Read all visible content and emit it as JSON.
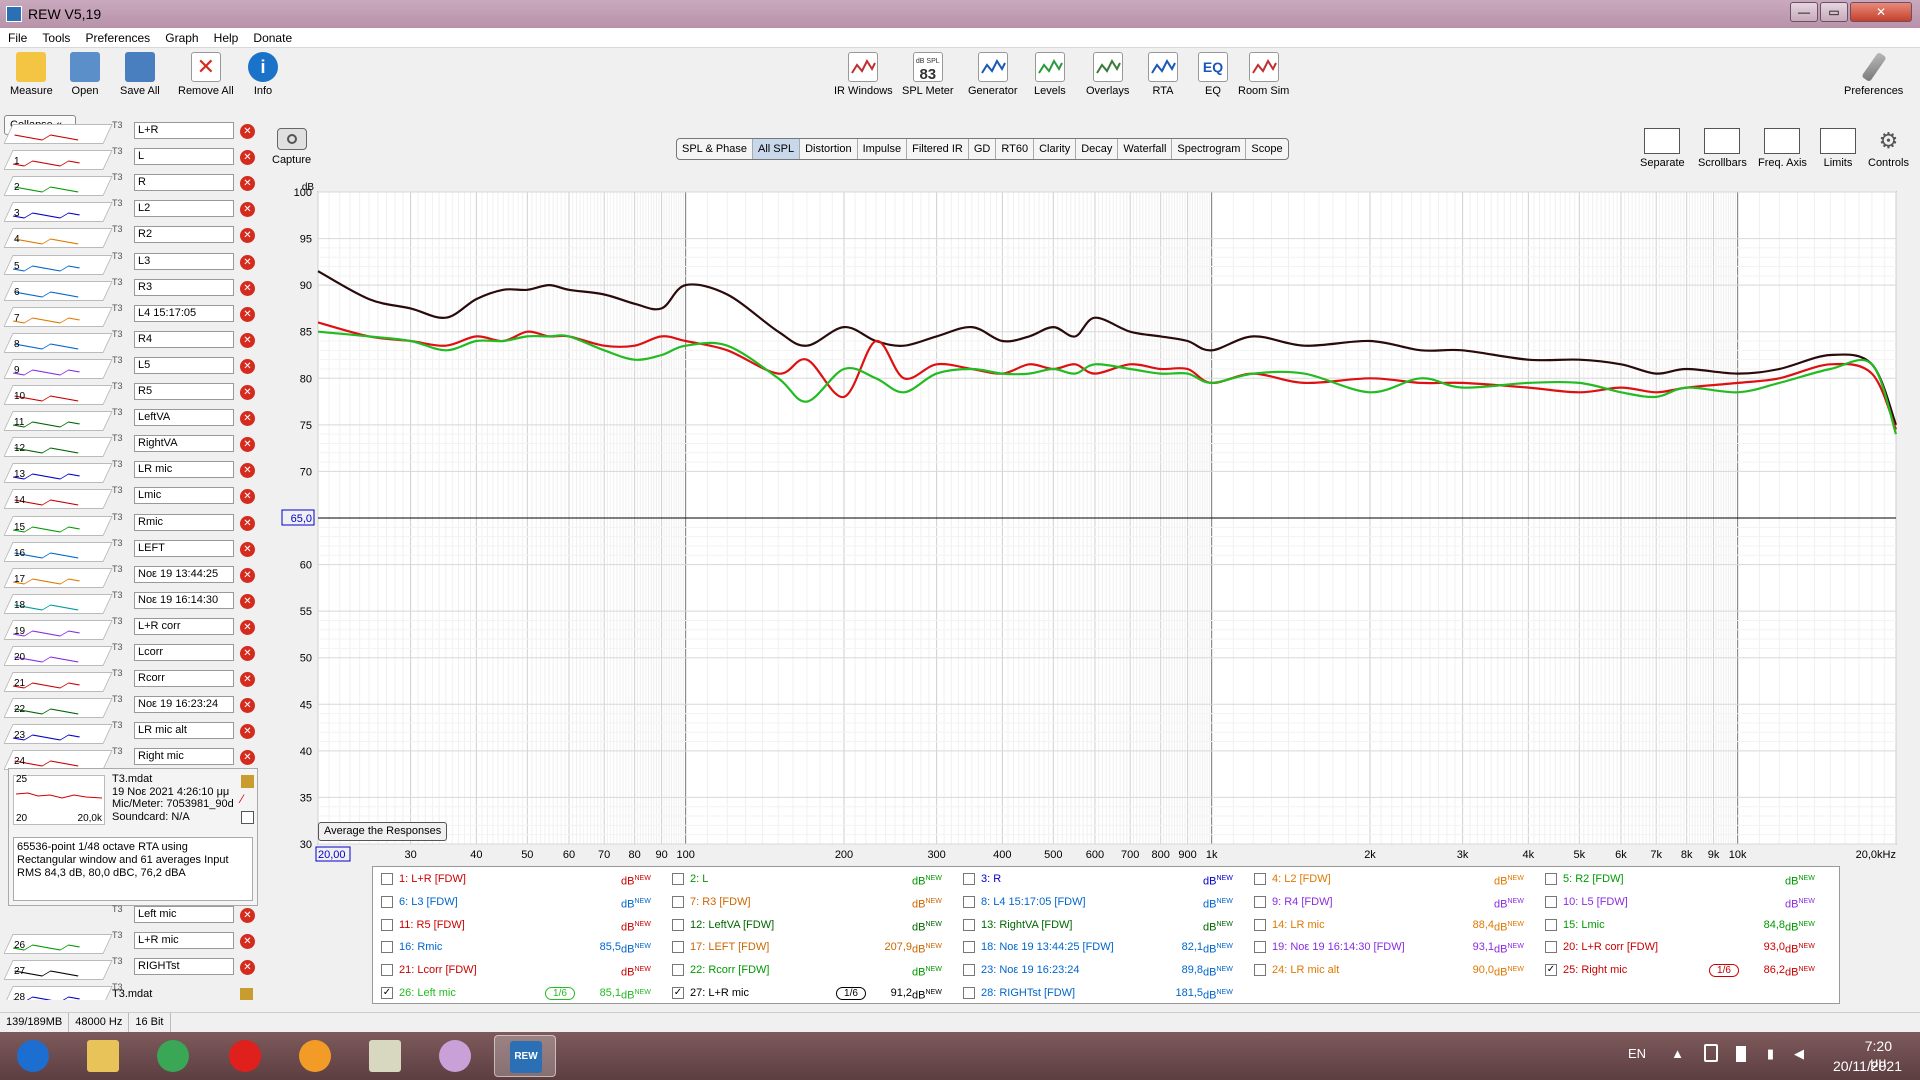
{
  "window": {
    "title": "REW V5,19",
    "minimize": "—",
    "maximize": "▭",
    "close": "✕"
  },
  "menu": [
    "File",
    "Tools",
    "Preferences",
    "Graph",
    "Help",
    "Donate"
  ],
  "toolbar_left": [
    {
      "label": "Measure",
      "icon": "measure-icon",
      "color": "#f4c542"
    },
    {
      "label": "Open",
      "icon": "folder-icon",
      "color": "#5b8fc9"
    },
    {
      "label": "Save All",
      "icon": "save-icon",
      "color": "#4a7fbf"
    },
    {
      "label": "Remove All",
      "icon": "remove-icon",
      "color": "#d42b1e"
    },
    {
      "label": "Info",
      "icon": "info-icon",
      "color": "#1a73c9"
    }
  ],
  "toolbar_center": [
    {
      "label": "IR Windows",
      "icon": "ir-windows-icon",
      "color": "#c03030"
    },
    {
      "label": "SPL Meter",
      "icon": "spl-meter-icon",
      "color": "#333333",
      "text_top": "dB SPL",
      "text_main": "83"
    },
    {
      "label": "Generator",
      "icon": "generator-icon",
      "color": "#1a57b8"
    },
    {
      "label": "Levels",
      "icon": "levels-icon",
      "color": "#2a9a3a"
    },
    {
      "label": "Overlays",
      "icon": "overlays-icon",
      "color": "#3a7a3a"
    },
    {
      "label": "RTA",
      "icon": "rta-icon",
      "color": "#1a57b8"
    },
    {
      "label": "EQ",
      "icon": "eq-icon",
      "color": "#1a57b8",
      "text_main": "EQ"
    },
    {
      "label": "Room Sim",
      "icon": "room-sim-icon",
      "color": "#c03030"
    }
  ],
  "preferences_label": "Preferences",
  "collapse_label": "Collapse",
  "measurements": [
    {
      "num": "",
      "name": "L+R",
      "color": "#cc0000"
    },
    {
      "num": "1",
      "name": "L",
      "color": "#cc0000"
    },
    {
      "num": "2",
      "name": "R",
      "color": "#009900"
    },
    {
      "num": "3",
      "name": "L2",
      "color": "#0000cc"
    },
    {
      "num": "4",
      "name": "R2",
      "color": "#e07800"
    },
    {
      "num": "5",
      "name": "L3",
      "color": "#0066cc"
    },
    {
      "num": "6",
      "name": "R3",
      "color": "#0066cc"
    },
    {
      "num": "7",
      "name": "L4 15:17:05",
      "color": "#e07800"
    },
    {
      "num": "8",
      "name": "R4",
      "color": "#0066cc"
    },
    {
      "num": "9",
      "name": "L5",
      "color": "#8a2be2"
    },
    {
      "num": "10",
      "name": "R5",
      "color": "#cc0000"
    },
    {
      "num": "11",
      "name": "LeftVA",
      "color": "#006600"
    },
    {
      "num": "12",
      "name": "RightVA",
      "color": "#006600"
    },
    {
      "num": "13",
      "name": "LR mic",
      "color": "#0000cc"
    },
    {
      "num": "14",
      "name": "Lmic",
      "color": "#cc0000"
    },
    {
      "num": "15",
      "name": "Rmic",
      "color": "#009900"
    },
    {
      "num": "16",
      "name": "LEFT",
      "color": "#0066cc"
    },
    {
      "num": "17",
      "name": "Noε 19 13:44:25",
      "color": "#e07800"
    },
    {
      "num": "18",
      "name": "Noε 19 16:14:30",
      "color": "#009999"
    },
    {
      "num": "19",
      "name": "L+R corr",
      "color": "#8a2be2"
    },
    {
      "num": "20",
      "name": "Lcorr",
      "color": "#8a2be2"
    },
    {
      "num": "21",
      "name": "Rcorr",
      "color": "#cc0000"
    },
    {
      "num": "22",
      "name": "Noε 19 16:23:24",
      "color": "#006600"
    },
    {
      "num": "23",
      "name": "LR mic alt",
      "color": "#0000cc"
    },
    {
      "num": "24",
      "name": "Right mic",
      "color": "#cc0000"
    }
  ],
  "selected_measurement": {
    "num": "25",
    "file": "T3.mdat",
    "date": "19 Νοε 2021 4:26:10 μμ",
    "mic": "Mic/Meter: 7053981_90d",
    "soundcard": "Soundcard: N/A",
    "thumb_lo": "20",
    "thumb_hi": "20,0k",
    "description": "65536-point 1/48 octave RTA using Rectangular window and 61 averages\nInput RMS 84,3 dB, 80,0 dBC, 76,2 dBA"
  },
  "measurements_below": [
    {
      "num": "",
      "name": "Left mic",
      "color": "#009900"
    },
    {
      "num": "26",
      "name": "L+R mic",
      "color": "#009900"
    },
    {
      "num": "27",
      "name": "RIGHTst",
      "color": "#000000"
    },
    {
      "num": "28",
      "name": "",
      "color": "#0000cc",
      "file": "T3.mdat"
    }
  ],
  "capture_label": "Capture",
  "graph_tabs": [
    "SPL & Phase",
    "All SPL",
    "Distortion",
    "Impulse",
    "Filtered IR",
    "GD",
    "RT60",
    "Clarity",
    "Decay",
    "Waterfall",
    "Spectrogram",
    "Scope"
  ],
  "active_tab": "All SPL",
  "right_tools": [
    "Separate",
    "Scrollbars",
    "Freq. Axis",
    "Limits",
    "Controls"
  ],
  "graph": {
    "y_unit": "dB",
    "y_ticks": [
      "100",
      "95",
      "90",
      "85",
      "80",
      "75",
      "70",
      "65,0",
      "60",
      "55",
      "50",
      "45",
      "40",
      "35",
      "30"
    ],
    "x_ticks": [
      "20,00",
      "30",
      "40",
      "50",
      "60",
      "70",
      "80",
      "90",
      "100",
      "200",
      "300",
      "400",
      "500",
      "600",
      "700",
      "800",
      "900",
      "1k",
      "2k",
      "3k",
      "4k",
      "5k",
      "6k",
      "7k",
      "8k",
      "9k",
      "10k",
      "20,0kHz"
    ],
    "cursor_db": "65,0"
  },
  "chart_data": {
    "type": "line",
    "xlabel": "",
    "ylabel": "dB",
    "xscale": "log",
    "xlim": [
      20,
      20000
    ],
    "ylim": [
      30,
      100
    ],
    "grid": true,
    "legend": "bottom",
    "series": [
      {
        "name": "27: L+R mic",
        "color": "#2a0a0a",
        "x": [
          20,
          25,
          30,
          35,
          40,
          45,
          50,
          55,
          60,
          70,
          80,
          90,
          100,
          120,
          150,
          170,
          200,
          230,
          260,
          300,
          350,
          400,
          450,
          500,
          550,
          600,
          700,
          800,
          900,
          1000,
          1200,
          1500,
          2000,
          2500,
          3000,
          4000,
          5000,
          6000,
          7000,
          8000,
          10000,
          12000,
          15000,
          18000,
          20000
        ],
        "y": [
          91.5,
          88.5,
          87.5,
          86.5,
          88.5,
          89.5,
          89.5,
          90.0,
          89.5,
          89.0,
          88.0,
          87.5,
          90.0,
          89.0,
          85.0,
          83.5,
          85.5,
          84.0,
          83.5,
          84.5,
          85.5,
          84.0,
          84.5,
          85.5,
          84.5,
          86.5,
          85.0,
          84.5,
          84.0,
          83.0,
          84.5,
          83.5,
          84.0,
          83.0,
          83.0,
          82.0,
          82.0,
          81.5,
          80.5,
          81.0,
          80.5,
          81.0,
          82.5,
          81.5,
          75.0
        ]
      },
      {
        "name": "25: Right mic",
        "color": "#dd1111",
        "x": [
          20,
          25,
          30,
          35,
          40,
          45,
          50,
          55,
          60,
          70,
          80,
          90,
          100,
          120,
          150,
          170,
          200,
          230,
          260,
          300,
          350,
          400,
          450,
          500,
          550,
          600,
          700,
          800,
          900,
          1000,
          1200,
          1500,
          2000,
          2500,
          3000,
          4000,
          5000,
          6000,
          7000,
          8000,
          10000,
          12000,
          15000,
          18000,
          20000
        ],
        "y": [
          86.0,
          84.5,
          84.0,
          83.5,
          84.5,
          84.0,
          85.0,
          84.5,
          84.5,
          83.5,
          83.5,
          84.5,
          84.0,
          83.0,
          80.5,
          82.0,
          78.0,
          84.0,
          80.0,
          81.5,
          81.0,
          80.5,
          81.5,
          81.0,
          81.5,
          80.5,
          81.5,
          81.0,
          81.0,
          79.5,
          80.5,
          79.5,
          80.0,
          79.5,
          79.5,
          79.0,
          78.5,
          79.0,
          78.5,
          79.0,
          79.5,
          80.0,
          81.5,
          80.5,
          74.5
        ]
      },
      {
        "name": "26: Left mic",
        "color": "#22bb22",
        "x": [
          20,
          25,
          30,
          35,
          40,
          45,
          50,
          55,
          60,
          70,
          80,
          90,
          100,
          120,
          150,
          170,
          200,
          230,
          260,
          300,
          350,
          400,
          450,
          500,
          550,
          600,
          700,
          800,
          900,
          1000,
          1200,
          1500,
          2000,
          2500,
          3000,
          4000,
          5000,
          6000,
          7000,
          8000,
          10000,
          12000,
          15000,
          18000,
          20000
        ],
        "y": [
          85.0,
          84.5,
          84.0,
          83.0,
          84.0,
          84.0,
          84.5,
          84.5,
          84.5,
          83.0,
          82.0,
          82.5,
          83.5,
          83.5,
          80.0,
          77.5,
          81.0,
          80.0,
          78.5,
          80.5,
          81.0,
          80.5,
          80.5,
          81.0,
          80.5,
          81.5,
          81.0,
          80.5,
          80.5,
          79.5,
          80.5,
          80.5,
          78.5,
          80.0,
          79.0,
          79.5,
          79.5,
          78.5,
          78.0,
          79.0,
          78.5,
          79.5,
          81.0,
          81.5,
          74.0
        ]
      }
    ]
  },
  "avg_button": "Average the Responses",
  "legend_items": [
    {
      "checked": false,
      "name": "1: L+R [FDW]",
      "value": "",
      "color": "#cc0000"
    },
    {
      "checked": false,
      "name": "2: L",
      "value": "",
      "color": "#009900"
    },
    {
      "checked": false,
      "name": "3: R",
      "value": "",
      "color": "#0000cc"
    },
    {
      "checked": false,
      "name": "4: L2 [FDW]",
      "value": "",
      "color": "#e07800"
    },
    {
      "checked": false,
      "name": "5: R2 [FDW]",
      "value": "",
      "color": "#009900"
    },
    {
      "checked": false,
      "name": "6: L3 [FDW]",
      "value": "",
      "color": "#0066cc"
    },
    {
      "checked": false,
      "name": "7: R3 [FDW]",
      "value": "",
      "color": "#cc6600"
    },
    {
      "checked": false,
      "name": "8: L4 15:17:05 [FDW]",
      "value": "",
      "color": "#0066cc"
    },
    {
      "checked": false,
      "name": "9: R4 [FDW]",
      "value": "",
      "color": "#8a2be2"
    },
    {
      "checked": false,
      "name": "10: L5 [FDW]",
      "value": "",
      "color": "#8a2be2"
    },
    {
      "checked": false,
      "name": "11: R5 [FDW]",
      "value": "",
      "color": "#cc0000"
    },
    {
      "checked": false,
      "name": "12: LeftVA [FDW]",
      "value": "",
      "color": "#006600"
    },
    {
      "checked": false,
      "name": "13: RightVA [FDW]",
      "value": "",
      "color": "#006600"
    },
    {
      "checked": false,
      "name": "14: LR mic",
      "value": "88,4",
      "color": "#e07800"
    },
    {
      "checked": false,
      "name": "15: Lmic",
      "value": "84,8",
      "color": "#009900"
    },
    {
      "checked": false,
      "name": "16: Rmic",
      "value": "85,5",
      "color": "#0066cc"
    },
    {
      "checked": false,
      "name": "17: LEFT [FDW]",
      "value": "207,9",
      "color": "#cc6600"
    },
    {
      "checked": false,
      "name": "18: Noε 19 13:44:25 [FDW]",
      "value": "82,1",
      "color": "#0066cc"
    },
    {
      "checked": false,
      "name": "19: Noε 19 16:14:30 [FDW]",
      "value": "93,1",
      "color": "#8a2be2"
    },
    {
      "checked": false,
      "name": "20: L+R corr [FDW]",
      "value": "93,0",
      "color": "#cc0000"
    },
    {
      "checked": false,
      "name": "21: Lcorr [FDW]",
      "value": "",
      "color": "#cc0000"
    },
    {
      "checked": false,
      "name": "22: Rcorr [FDW]",
      "value": "",
      "color": "#009900"
    },
    {
      "checked": false,
      "name": "23: Noε 19 16:23:24",
      "value": "89,8",
      "color": "#0066cc"
    },
    {
      "checked": false,
      "name": "24: LR mic alt",
      "value": "90,0",
      "color": "#e07800"
    },
    {
      "checked": true,
      "name": "25: Right mic",
      "value": "86,2",
      "color": "#cc0000",
      "smoothing": "1/6"
    },
    {
      "checked": true,
      "name": "26: Left mic",
      "value": "85,1",
      "color": "#22bb22",
      "smoothing": "1/6"
    },
    {
      "checked": true,
      "name": "27: L+R mic",
      "value": "91,2",
      "color": "#000000",
      "smoothing": "1/6"
    },
    {
      "checked": false,
      "name": "28: RIGHTst [FDW]",
      "value": "181,5",
      "color": "#0066cc"
    }
  ],
  "legend_unit": "dB",
  "legend_unit_sup": "NEW",
  "status": [
    "139/189MB",
    "48000 Hz",
    "16 Bit"
  ],
  "taskbar": {
    "apps": [
      {
        "name": "start-icon",
        "color": "#1c6fd1"
      },
      {
        "name": "explorer-icon",
        "color": "#e8c35a"
      },
      {
        "name": "chrome-icon",
        "color": "#3aa757"
      },
      {
        "name": "opera-icon",
        "color": "#e0201c"
      },
      {
        "name": "firefox-icon",
        "color": "#f39b27"
      },
      {
        "name": "notepad-icon",
        "color": "#d8d8c0"
      },
      {
        "name": "paint-icon",
        "color": "#c9a0d8"
      },
      {
        "name": "rew-icon",
        "color": "#2b6fb5",
        "label": "REW"
      }
    ],
    "lang": "EN",
    "time": "7:20 μμ",
    "date": "20/11/2021"
  }
}
